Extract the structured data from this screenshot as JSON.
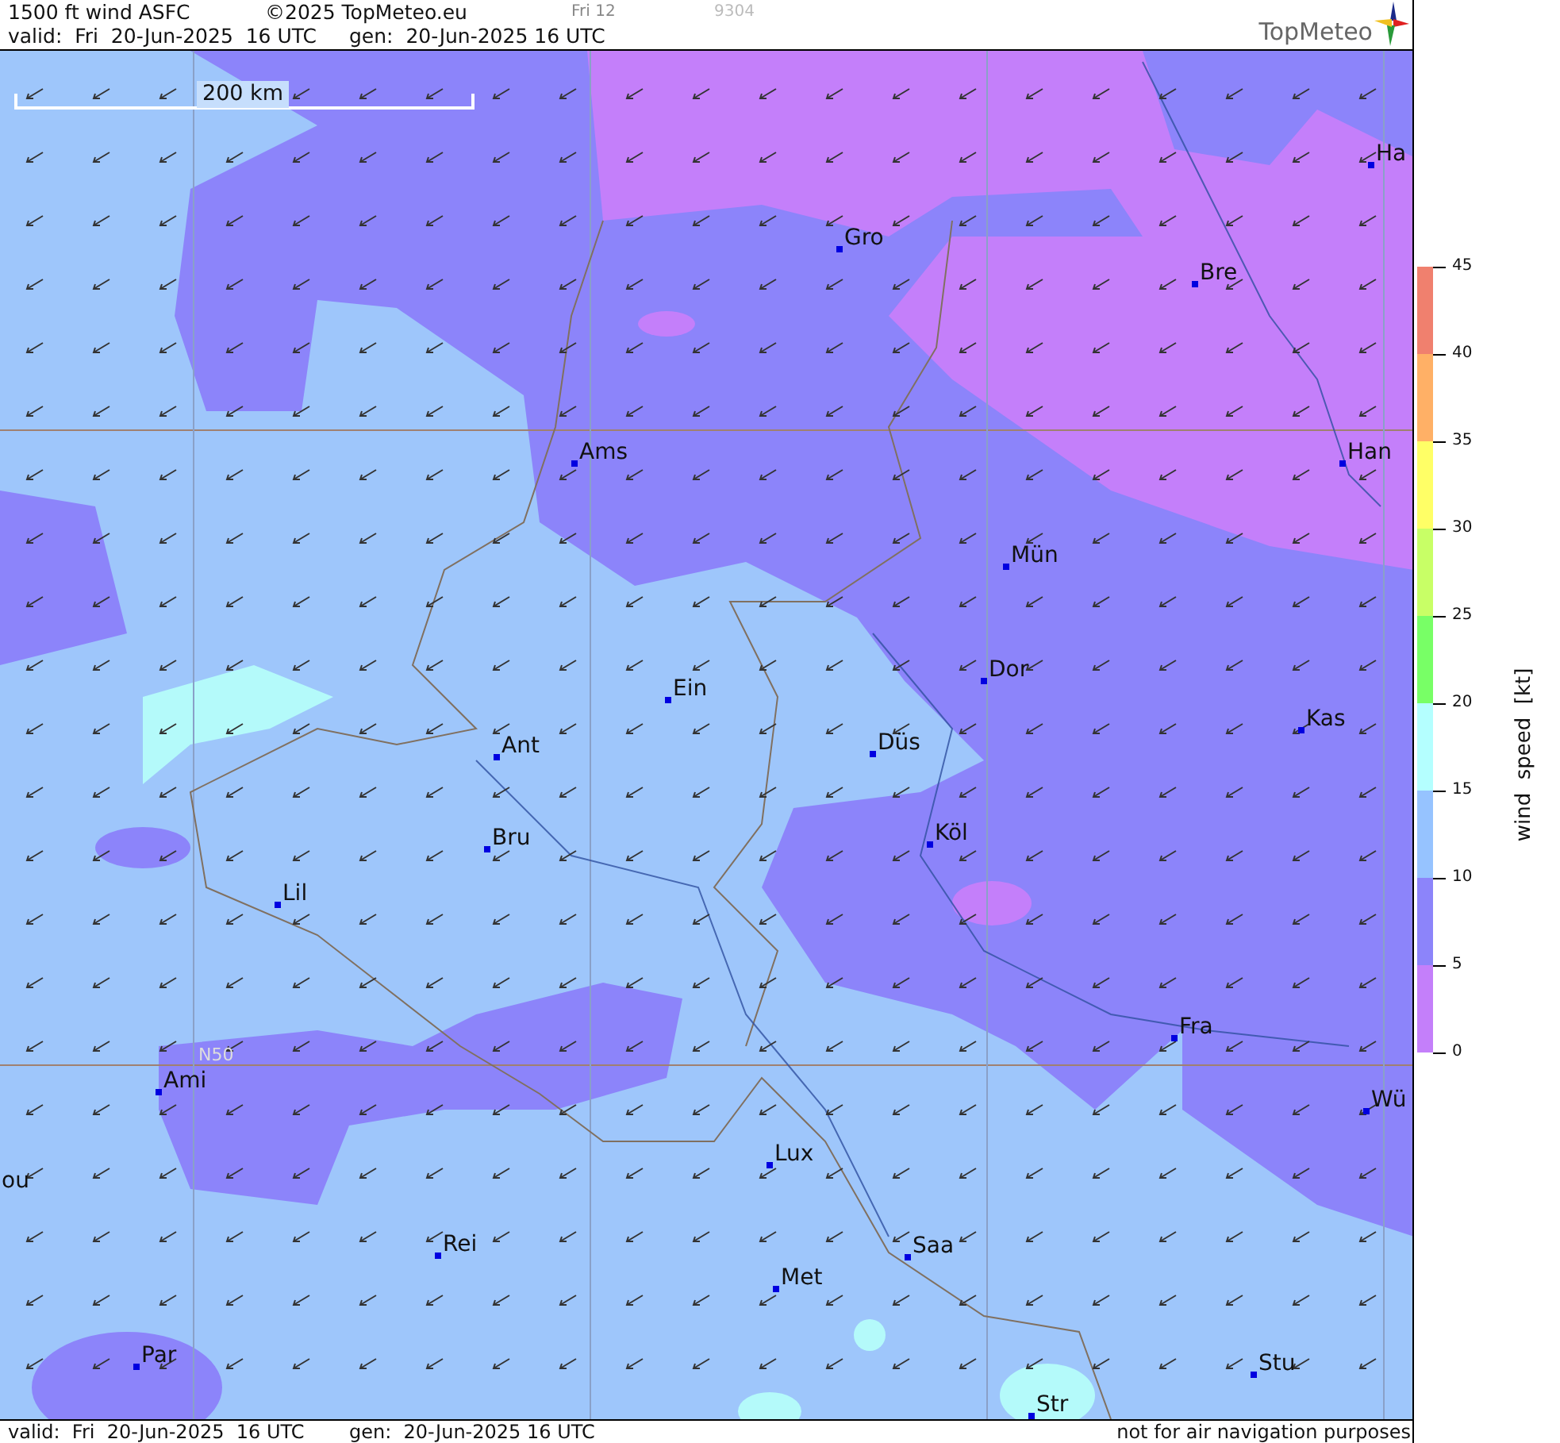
{
  "header": {
    "title": "1500 ft wind ASFC",
    "copyright": "©2025 TopMeteo.eu",
    "frame": "Fri 12",
    "code": "9304",
    "valid": "valid:  Fri  20-Jun-2025  16 UTC",
    "generated": "gen:  20-Jun-2025 16 UTC"
  },
  "logo": {
    "text": "TopMeteo"
  },
  "map": {
    "scale_label": "200 km",
    "grid_label": "N50",
    "cities": [
      {
        "name": "Ha"
      },
      {
        "name": "Gro"
      },
      {
        "name": "Bre"
      },
      {
        "name": "Ams"
      },
      {
        "name": "Han"
      },
      {
        "name": "Mün"
      },
      {
        "name": "Dor"
      },
      {
        "name": "Ein"
      },
      {
        "name": "Kas"
      },
      {
        "name": "Düs"
      },
      {
        "name": "Ant"
      },
      {
        "name": "Köl"
      },
      {
        "name": "Bru"
      },
      {
        "name": "Lil"
      },
      {
        "name": "Fra"
      },
      {
        "name": "Ami"
      },
      {
        "name": "Wü"
      },
      {
        "name": "Lux"
      },
      {
        "name": "ou"
      },
      {
        "name": "Rei"
      },
      {
        "name": "Saa"
      },
      {
        "name": "Met"
      },
      {
        "name": "Par"
      },
      {
        "name": "Stu"
      },
      {
        "name": "Str"
      }
    ]
  },
  "legend": {
    "title": "wind  speed  [kt]",
    "ticks": [
      "45",
      "40",
      "35",
      "30",
      "25",
      "20",
      "15",
      "10",
      "5",
      "0"
    ],
    "segments": [
      {
        "color": "#f0806e"
      },
      {
        "color": "#ffb066"
      },
      {
        "color": "#ffff66"
      },
      {
        "color": "#c8ff66"
      },
      {
        "color": "#78ff66"
      },
      {
        "color": "#b4ffff"
      },
      {
        "color": "#96c3ff"
      },
      {
        "color": "#8c84fa"
      },
      {
        "color": "#c47ffa"
      }
    ]
  },
  "footer": {
    "valid": "valid:  Fri  20-Jun-2025  16 UTC",
    "generated": "gen:  20-Jun-2025 16 UTC",
    "disclaimer": "not for air navigation purposes"
  }
}
